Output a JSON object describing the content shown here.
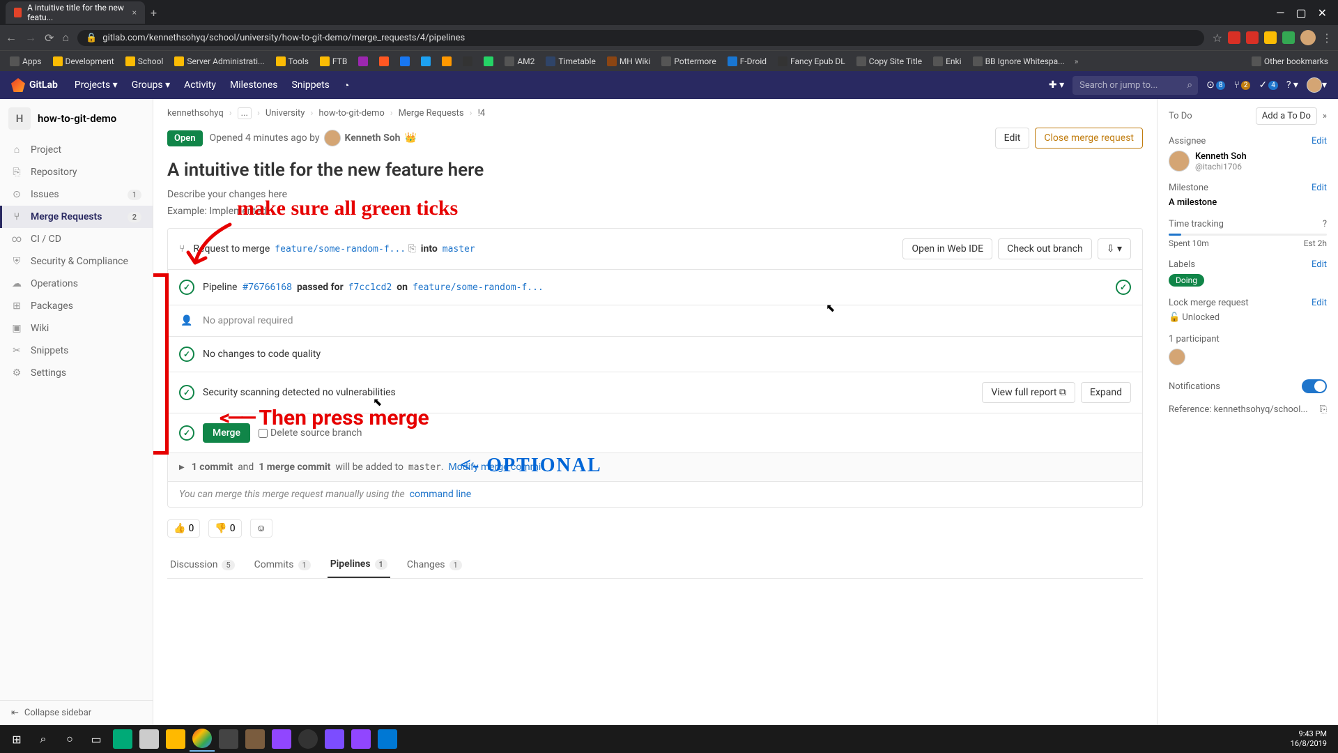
{
  "browser": {
    "tab_title": "A intuitive title for the new featu...",
    "url": "gitlab.com/kennethsohyq/school/university/how-to-git-demo/merge_requests/4/pipelines",
    "bookmarks": [
      "Apps",
      "Development",
      "School",
      "Server Administrati...",
      "Tools",
      "FTB",
      "",
      "",
      "",
      "",
      "",
      "AM2",
      "Timetable",
      "MH Wiki",
      "Pottermore",
      "F-Droid",
      "Fancy Epub DL",
      "Copy Site Title",
      "Enki",
      "BB Ignore Whitespa..."
    ],
    "other_bookmarks": "Other bookmarks"
  },
  "gitlab": {
    "brand": "GitLab",
    "nav": {
      "projects": "Projects",
      "groups": "Groups",
      "activity": "Activity",
      "milestones": "Milestones",
      "snippets": "Snippets"
    },
    "search_placeholder": "Search or jump to...",
    "counts": {
      "issues": "8",
      "mrs": "2",
      "todos": "4"
    }
  },
  "sidebar": {
    "project_letter": "H",
    "project_name": "how-to-git-demo",
    "items": [
      {
        "icon": "⌂",
        "label": "Project"
      },
      {
        "icon": "⎘",
        "label": "Repository"
      },
      {
        "icon": "⊙",
        "label": "Issues",
        "count": "1"
      },
      {
        "icon": "⑂",
        "label": "Merge Requests",
        "count": "2",
        "active": true
      },
      {
        "icon": "∞",
        "label": "CI / CD"
      },
      {
        "icon": "⛨",
        "label": "Security & Compliance"
      },
      {
        "icon": "☁",
        "label": "Operations"
      },
      {
        "icon": "⊞",
        "label": "Packages"
      },
      {
        "icon": "▣",
        "label": "Wiki"
      },
      {
        "icon": "✂",
        "label": "Snippets"
      },
      {
        "icon": "⚙",
        "label": "Settings"
      }
    ],
    "collapse": "Collapse sidebar"
  },
  "breadcrumbs": [
    "kennethsohyq",
    "...",
    "University",
    "how-to-git-demo",
    "Merge Requests",
    "!4"
  ],
  "mr": {
    "status": "Open",
    "opened": "Opened 4 minutes ago by",
    "author": "Kenneth Soh",
    "edit": "Edit",
    "close": "Close merge request",
    "title": "A intuitive title for the new feature here",
    "desc1": "Describe your changes here",
    "desc2": "Example: Implemented",
    "request_to_merge": "Request to merge",
    "source_branch": "feature/some-random-f...",
    "into": "into",
    "target_branch": "master",
    "open_ide": "Open in Web IDE",
    "checkout": "Check out branch",
    "pipeline_label": "Pipeline",
    "pipeline_id": "#76766168",
    "pipeline_passed": "passed for",
    "commit_sha": "f7cc1cd2",
    "on": "on",
    "pipeline_branch": "feature/some-random-f...",
    "no_approval": "No approval required",
    "code_quality": "No changes to code quality",
    "security": "Security scanning detected no vulnerabilities",
    "view_report": "View full report",
    "expand": "Expand",
    "merge_btn": "Merge",
    "delete_source": "Delete source branch",
    "commit_info_1": "1 commit",
    "commit_info_and": "and",
    "commit_info_2": "1 merge commit",
    "commit_info_3": "will be added to",
    "commit_info_target": "master",
    "modify": "Modify merge commit",
    "manual": "You can merge this merge request manually using the",
    "command_line": "command line",
    "thumbs_up": "0",
    "thumbs_down": "0"
  },
  "tabs": [
    {
      "label": "Discussion",
      "count": "5"
    },
    {
      "label": "Commits",
      "count": "1"
    },
    {
      "label": "Pipelines",
      "count": "1",
      "active": true
    },
    {
      "label": "Changes",
      "count": "1"
    }
  ],
  "rsidebar": {
    "todo": "To Do",
    "add_todo": "Add a To Do",
    "assignee": "Assignee",
    "edit": "Edit",
    "assignee_name": "Kenneth Soh",
    "assignee_handle": "@itachi1706",
    "milestone": "Milestone",
    "milestone_value": "A milestone",
    "time_tracking": "Time tracking",
    "spent": "Spent 10m",
    "est": "Est 2h",
    "labels": "Labels",
    "label_value": "Doing",
    "lock": "Lock merge request",
    "unlocked": "Unlocked",
    "participants": "1 participant",
    "notifications": "Notifications",
    "reference": "Reference: kennethsohyq/school..."
  },
  "annotations": {
    "text1": "make sure all green ticks",
    "text2": "Then press merge",
    "text3": "<- OPTIONAL"
  },
  "taskbar": {
    "time": "9:43 PM",
    "date": "16/8/2019"
  }
}
